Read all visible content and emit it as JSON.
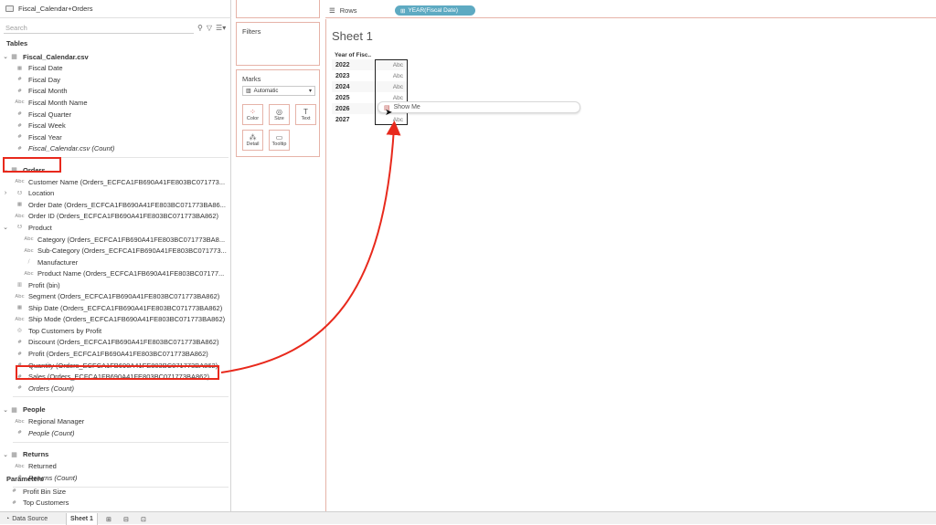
{
  "datasource": {
    "name": "Fiscal_Calendar+Orders"
  },
  "search": {
    "placeholder": "Search",
    "filter_icon": "filter-icon",
    "menu_icon": "view-list-icon"
  },
  "tables_header": "Tables",
  "groups": [
    {
      "name": "Fiscal_Calendar.csv",
      "fields": [
        {
          "icon": "▦",
          "label": "Fiscal Date",
          "italic": false
        },
        {
          "icon": "#",
          "label": "Fiscal Day",
          "italic": false
        },
        {
          "icon": "#",
          "label": "Fiscal Month",
          "italic": false
        },
        {
          "icon": "Abc",
          "label": "Fiscal Month Name",
          "italic": false
        },
        {
          "icon": "#",
          "label": "Fiscal Quarter",
          "italic": false
        },
        {
          "icon": "#",
          "label": "Fiscal Week",
          "italic": false
        },
        {
          "icon": "#",
          "label": "Fiscal Year",
          "italic": false
        },
        {
          "icon": "#",
          "label": "Fiscal_Calendar.csv (Count)",
          "italic": true
        }
      ]
    },
    {
      "name": "Orders",
      "fields": [
        {
          "icon": "Abc",
          "label": "Customer Name (Orders_ECFCA1FB690A41FE803BC071773...",
          "italic": false
        },
        {
          "icon": "☋",
          "label": "Location",
          "italic": false,
          "chevron": "›"
        },
        {
          "icon": "▦",
          "label": "Order Date (Orders_ECFCA1FB690A41FE803BC071773BA86...",
          "italic": false
        },
        {
          "icon": "Abc",
          "label": "Order ID (Orders_ECFCA1FB690A41FE803BC071773BA862)",
          "italic": false
        },
        {
          "icon": "☋",
          "label": "Product",
          "italic": false,
          "chevron": "⌄"
        },
        {
          "icon": "Abc",
          "label": "Category (Orders_ECFCA1FB690A41FE803BC071773BA8...",
          "italic": false,
          "indent": true
        },
        {
          "icon": "Abc",
          "label": "Sub-Category (Orders_ECFCA1FB690A41FE803BC071773...",
          "italic": false,
          "indent": true
        },
        {
          "icon": "⧸",
          "label": "Manufacturer",
          "italic": false,
          "indent": true
        },
        {
          "icon": "Abc",
          "label": "Product Name (Orders_ECFCA1FB690A41FE803BC07177...",
          "italic": false,
          "indent": true
        },
        {
          "icon": "▥",
          "label": "Profit (bin)",
          "italic": false
        },
        {
          "icon": "Abc",
          "label": "Segment (Orders_ECFCA1FB690A41FE803BC071773BA862)",
          "italic": false
        },
        {
          "icon": "▦",
          "label": "Ship Date (Orders_ECFCA1FB690A41FE803BC071773BA862)",
          "italic": false
        },
        {
          "icon": "Abc",
          "label": "Ship Mode (Orders_ECFCA1FB690A41FE803BC071773BA862)",
          "italic": false
        },
        {
          "icon": "◎",
          "label": "Top Customers by Profit",
          "italic": false
        },
        {
          "icon": "#",
          "label": "Discount (Orders_ECFCA1FB690A41FE803BC071773BA862)",
          "italic": false
        },
        {
          "icon": "#",
          "label": "Profit (Orders_ECFCA1FB690A41FE803BC071773BA862)",
          "italic": false
        },
        {
          "icon": "#",
          "label": "Quantity (Orders_ECFCA1FB690A41FE803BC071773BA862)",
          "italic": false
        },
        {
          "icon": "#",
          "label": "Sales (Orders_ECFCA1FB690A41FE803BC071773BA862)",
          "italic": false
        },
        {
          "icon": "#",
          "label": "Orders (Count)",
          "italic": true
        }
      ]
    },
    {
      "name": "People",
      "fields": [
        {
          "icon": "Abc",
          "label": "Regional Manager",
          "italic": false
        },
        {
          "icon": "#",
          "label": "People (Count)",
          "italic": true
        }
      ]
    },
    {
      "name": "Returns",
      "fields": [
        {
          "icon": "Abc",
          "label": "Returned",
          "italic": false
        },
        {
          "icon": "#",
          "label": "Returns (Count)",
          "italic": true
        }
      ]
    }
  ],
  "parameters": {
    "header": "Parameters",
    "items": [
      {
        "icon": "#",
        "label": "Profit Bin Size"
      },
      {
        "icon": "#",
        "label": "Top Customers"
      }
    ]
  },
  "shelves": {
    "filters_title": "Filters",
    "marks_title": "Marks",
    "marks_type": "Automatic",
    "mark_buttons": [
      {
        "label": "Color",
        "icon": "color-icon"
      },
      {
        "label": "Size",
        "icon": "size-icon"
      },
      {
        "label": "Text",
        "icon": "text-icon"
      },
      {
        "label": "Detail",
        "icon": "detail-icon"
      },
      {
        "label": "Tooltip",
        "icon": "tooltip-icon"
      }
    ]
  },
  "rows_shelf": {
    "label": "Rows",
    "pill": "YEAR(Fiscal Date)"
  },
  "sheet": {
    "title": "Sheet 1",
    "column_header": "Year of Fisc..",
    "rows": [
      {
        "year": "2022",
        "value": "Abc"
      },
      {
        "year": "2023",
        "value": "Abc"
      },
      {
        "year": "2024",
        "value": "Abc"
      },
      {
        "year": "2025",
        "value": "Abc"
      },
      {
        "year": "2026",
        "value": ""
      },
      {
        "year": "2027",
        "value": "Abc"
      }
    ],
    "show_me": "Show Me"
  },
  "tabs": {
    "data_source": "Data Source",
    "sheet1": "Sheet 1"
  },
  "colors": {
    "highlight": "#e8291c",
    "pill": "#5eaac2",
    "shelf_border": "#e6b3a8"
  }
}
